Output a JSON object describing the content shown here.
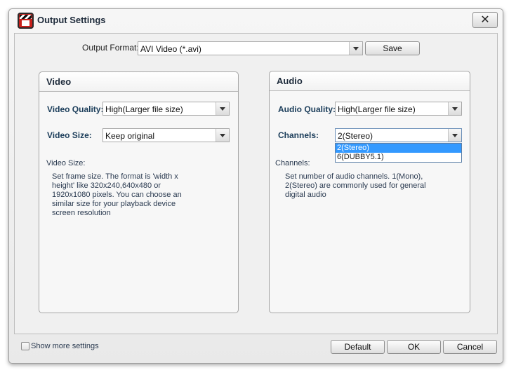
{
  "window": {
    "title": "Output Settings",
    "close_glyph": "✕"
  },
  "format": {
    "label": "Output Format:",
    "value": "AVI Video (*.avi)",
    "save_label": "Save"
  },
  "video": {
    "title": "Video",
    "quality_label": "Video Quality:",
    "quality_value": "High(Larger file size)",
    "size_label": "Video Size:",
    "size_value": "Keep original",
    "help_title": "Video Size:",
    "help_text": "Set frame size. The format is 'width x height' like 320x240,640x480 or 1920x1080 pixels. You can choose an similar size for your playback device screen resolution"
  },
  "audio": {
    "title": "Audio",
    "quality_label": "Audio Quality:",
    "quality_value": "High(Larger file size)",
    "channels_label": "Channels:",
    "channels_value": "2(Stereo)",
    "channels_options": [
      "2(Stereo)",
      "6(DUBBY5.1)"
    ],
    "help_title": "Channels:",
    "help_text": "Set number of audio channels. 1(Mono), 2(Stereo) are commonly used for general digital audio"
  },
  "footer": {
    "show_more_label": "Show more settings",
    "default_label": "Default",
    "ok_label": "OK",
    "cancel_label": "Cancel"
  },
  "icons": {
    "app": "clapperboard-icon",
    "close": "close-icon",
    "dropdown": "chevron-down-icon"
  }
}
